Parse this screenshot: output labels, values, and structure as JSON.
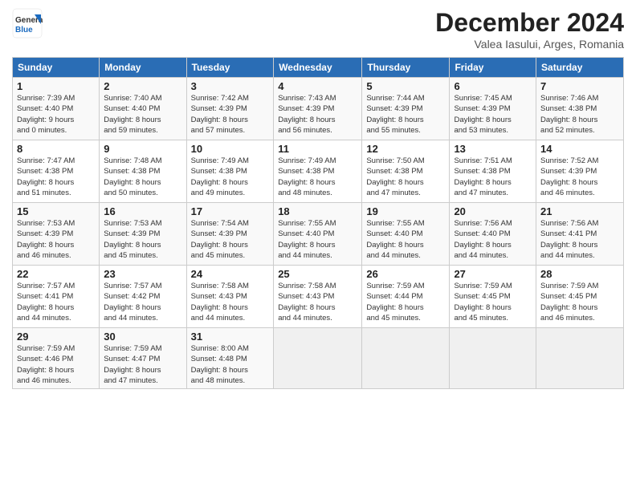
{
  "header": {
    "logo_general": "General",
    "logo_blue": "Blue",
    "month_title": "December 2024",
    "location": "Valea Iasului, Arges, Romania"
  },
  "days_of_week": [
    "Sunday",
    "Monday",
    "Tuesday",
    "Wednesday",
    "Thursday",
    "Friday",
    "Saturday"
  ],
  "weeks": [
    [
      {
        "day": "1",
        "info": "Sunrise: 7:39 AM\nSunset: 4:40 PM\nDaylight: 9 hours\nand 0 minutes."
      },
      {
        "day": "2",
        "info": "Sunrise: 7:40 AM\nSunset: 4:40 PM\nDaylight: 8 hours\nand 59 minutes."
      },
      {
        "day": "3",
        "info": "Sunrise: 7:42 AM\nSunset: 4:39 PM\nDaylight: 8 hours\nand 57 minutes."
      },
      {
        "day": "4",
        "info": "Sunrise: 7:43 AM\nSunset: 4:39 PM\nDaylight: 8 hours\nand 56 minutes."
      },
      {
        "day": "5",
        "info": "Sunrise: 7:44 AM\nSunset: 4:39 PM\nDaylight: 8 hours\nand 55 minutes."
      },
      {
        "day": "6",
        "info": "Sunrise: 7:45 AM\nSunset: 4:39 PM\nDaylight: 8 hours\nand 53 minutes."
      },
      {
        "day": "7",
        "info": "Sunrise: 7:46 AM\nSunset: 4:38 PM\nDaylight: 8 hours\nand 52 minutes."
      }
    ],
    [
      {
        "day": "8",
        "info": "Sunrise: 7:47 AM\nSunset: 4:38 PM\nDaylight: 8 hours\nand 51 minutes."
      },
      {
        "day": "9",
        "info": "Sunrise: 7:48 AM\nSunset: 4:38 PM\nDaylight: 8 hours\nand 50 minutes."
      },
      {
        "day": "10",
        "info": "Sunrise: 7:49 AM\nSunset: 4:38 PM\nDaylight: 8 hours\nand 49 minutes."
      },
      {
        "day": "11",
        "info": "Sunrise: 7:49 AM\nSunset: 4:38 PM\nDaylight: 8 hours\nand 48 minutes."
      },
      {
        "day": "12",
        "info": "Sunrise: 7:50 AM\nSunset: 4:38 PM\nDaylight: 8 hours\nand 47 minutes."
      },
      {
        "day": "13",
        "info": "Sunrise: 7:51 AM\nSunset: 4:38 PM\nDaylight: 8 hours\nand 47 minutes."
      },
      {
        "day": "14",
        "info": "Sunrise: 7:52 AM\nSunset: 4:39 PM\nDaylight: 8 hours\nand 46 minutes."
      }
    ],
    [
      {
        "day": "15",
        "info": "Sunrise: 7:53 AM\nSunset: 4:39 PM\nDaylight: 8 hours\nand 46 minutes."
      },
      {
        "day": "16",
        "info": "Sunrise: 7:53 AM\nSunset: 4:39 PM\nDaylight: 8 hours\nand 45 minutes."
      },
      {
        "day": "17",
        "info": "Sunrise: 7:54 AM\nSunset: 4:39 PM\nDaylight: 8 hours\nand 45 minutes."
      },
      {
        "day": "18",
        "info": "Sunrise: 7:55 AM\nSunset: 4:40 PM\nDaylight: 8 hours\nand 44 minutes."
      },
      {
        "day": "19",
        "info": "Sunrise: 7:55 AM\nSunset: 4:40 PM\nDaylight: 8 hours\nand 44 minutes."
      },
      {
        "day": "20",
        "info": "Sunrise: 7:56 AM\nSunset: 4:40 PM\nDaylight: 8 hours\nand 44 minutes."
      },
      {
        "day": "21",
        "info": "Sunrise: 7:56 AM\nSunset: 4:41 PM\nDaylight: 8 hours\nand 44 minutes."
      }
    ],
    [
      {
        "day": "22",
        "info": "Sunrise: 7:57 AM\nSunset: 4:41 PM\nDaylight: 8 hours\nand 44 minutes."
      },
      {
        "day": "23",
        "info": "Sunrise: 7:57 AM\nSunset: 4:42 PM\nDaylight: 8 hours\nand 44 minutes."
      },
      {
        "day": "24",
        "info": "Sunrise: 7:58 AM\nSunset: 4:43 PM\nDaylight: 8 hours\nand 44 minutes."
      },
      {
        "day": "25",
        "info": "Sunrise: 7:58 AM\nSunset: 4:43 PM\nDaylight: 8 hours\nand 44 minutes."
      },
      {
        "day": "26",
        "info": "Sunrise: 7:59 AM\nSunset: 4:44 PM\nDaylight: 8 hours\nand 45 minutes."
      },
      {
        "day": "27",
        "info": "Sunrise: 7:59 AM\nSunset: 4:45 PM\nDaylight: 8 hours\nand 45 minutes."
      },
      {
        "day": "28",
        "info": "Sunrise: 7:59 AM\nSunset: 4:45 PM\nDaylight: 8 hours\nand 46 minutes."
      }
    ],
    [
      {
        "day": "29",
        "info": "Sunrise: 7:59 AM\nSunset: 4:46 PM\nDaylight: 8 hours\nand 46 minutes."
      },
      {
        "day": "30",
        "info": "Sunrise: 7:59 AM\nSunset: 4:47 PM\nDaylight: 8 hours\nand 47 minutes."
      },
      {
        "day": "31",
        "info": "Sunrise: 8:00 AM\nSunset: 4:48 PM\nDaylight: 8 hours\nand 48 minutes."
      },
      {
        "day": "",
        "info": ""
      },
      {
        "day": "",
        "info": ""
      },
      {
        "day": "",
        "info": ""
      },
      {
        "day": "",
        "info": ""
      }
    ]
  ]
}
